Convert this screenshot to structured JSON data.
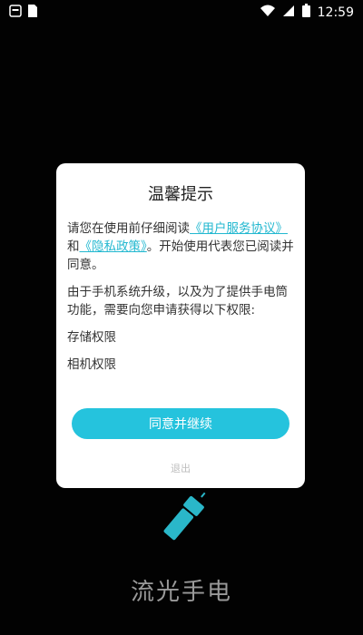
{
  "status_bar": {
    "time": "12:59",
    "icons": [
      "notification-icon",
      "sim-icon",
      "wifi-icon",
      "signal-icon",
      "battery-icon"
    ]
  },
  "dialog": {
    "title": "温馨提示",
    "paragraph1_prefix": "请您在使用前仔细阅读",
    "user_agreement_link": "《用户服务协议》",
    "and_text": "和",
    "privacy_link": "《隐私政策》",
    "paragraph1_suffix": "。开始使用代表您已阅读并同意。",
    "paragraph2": "由于手机系统升级，以及为了提供手电筒功能，需要向您申请获得以下权限:",
    "permission_storage": "存储权限",
    "permission_camera": "相机权限",
    "agree_button": "同意并继续",
    "exit_button": "退出"
  },
  "app": {
    "name": "流光手电",
    "icon": "flashlight-icon"
  },
  "colors": {
    "accent": "#25c3dd",
    "link": "#23b8d0",
    "background": "#020202"
  }
}
